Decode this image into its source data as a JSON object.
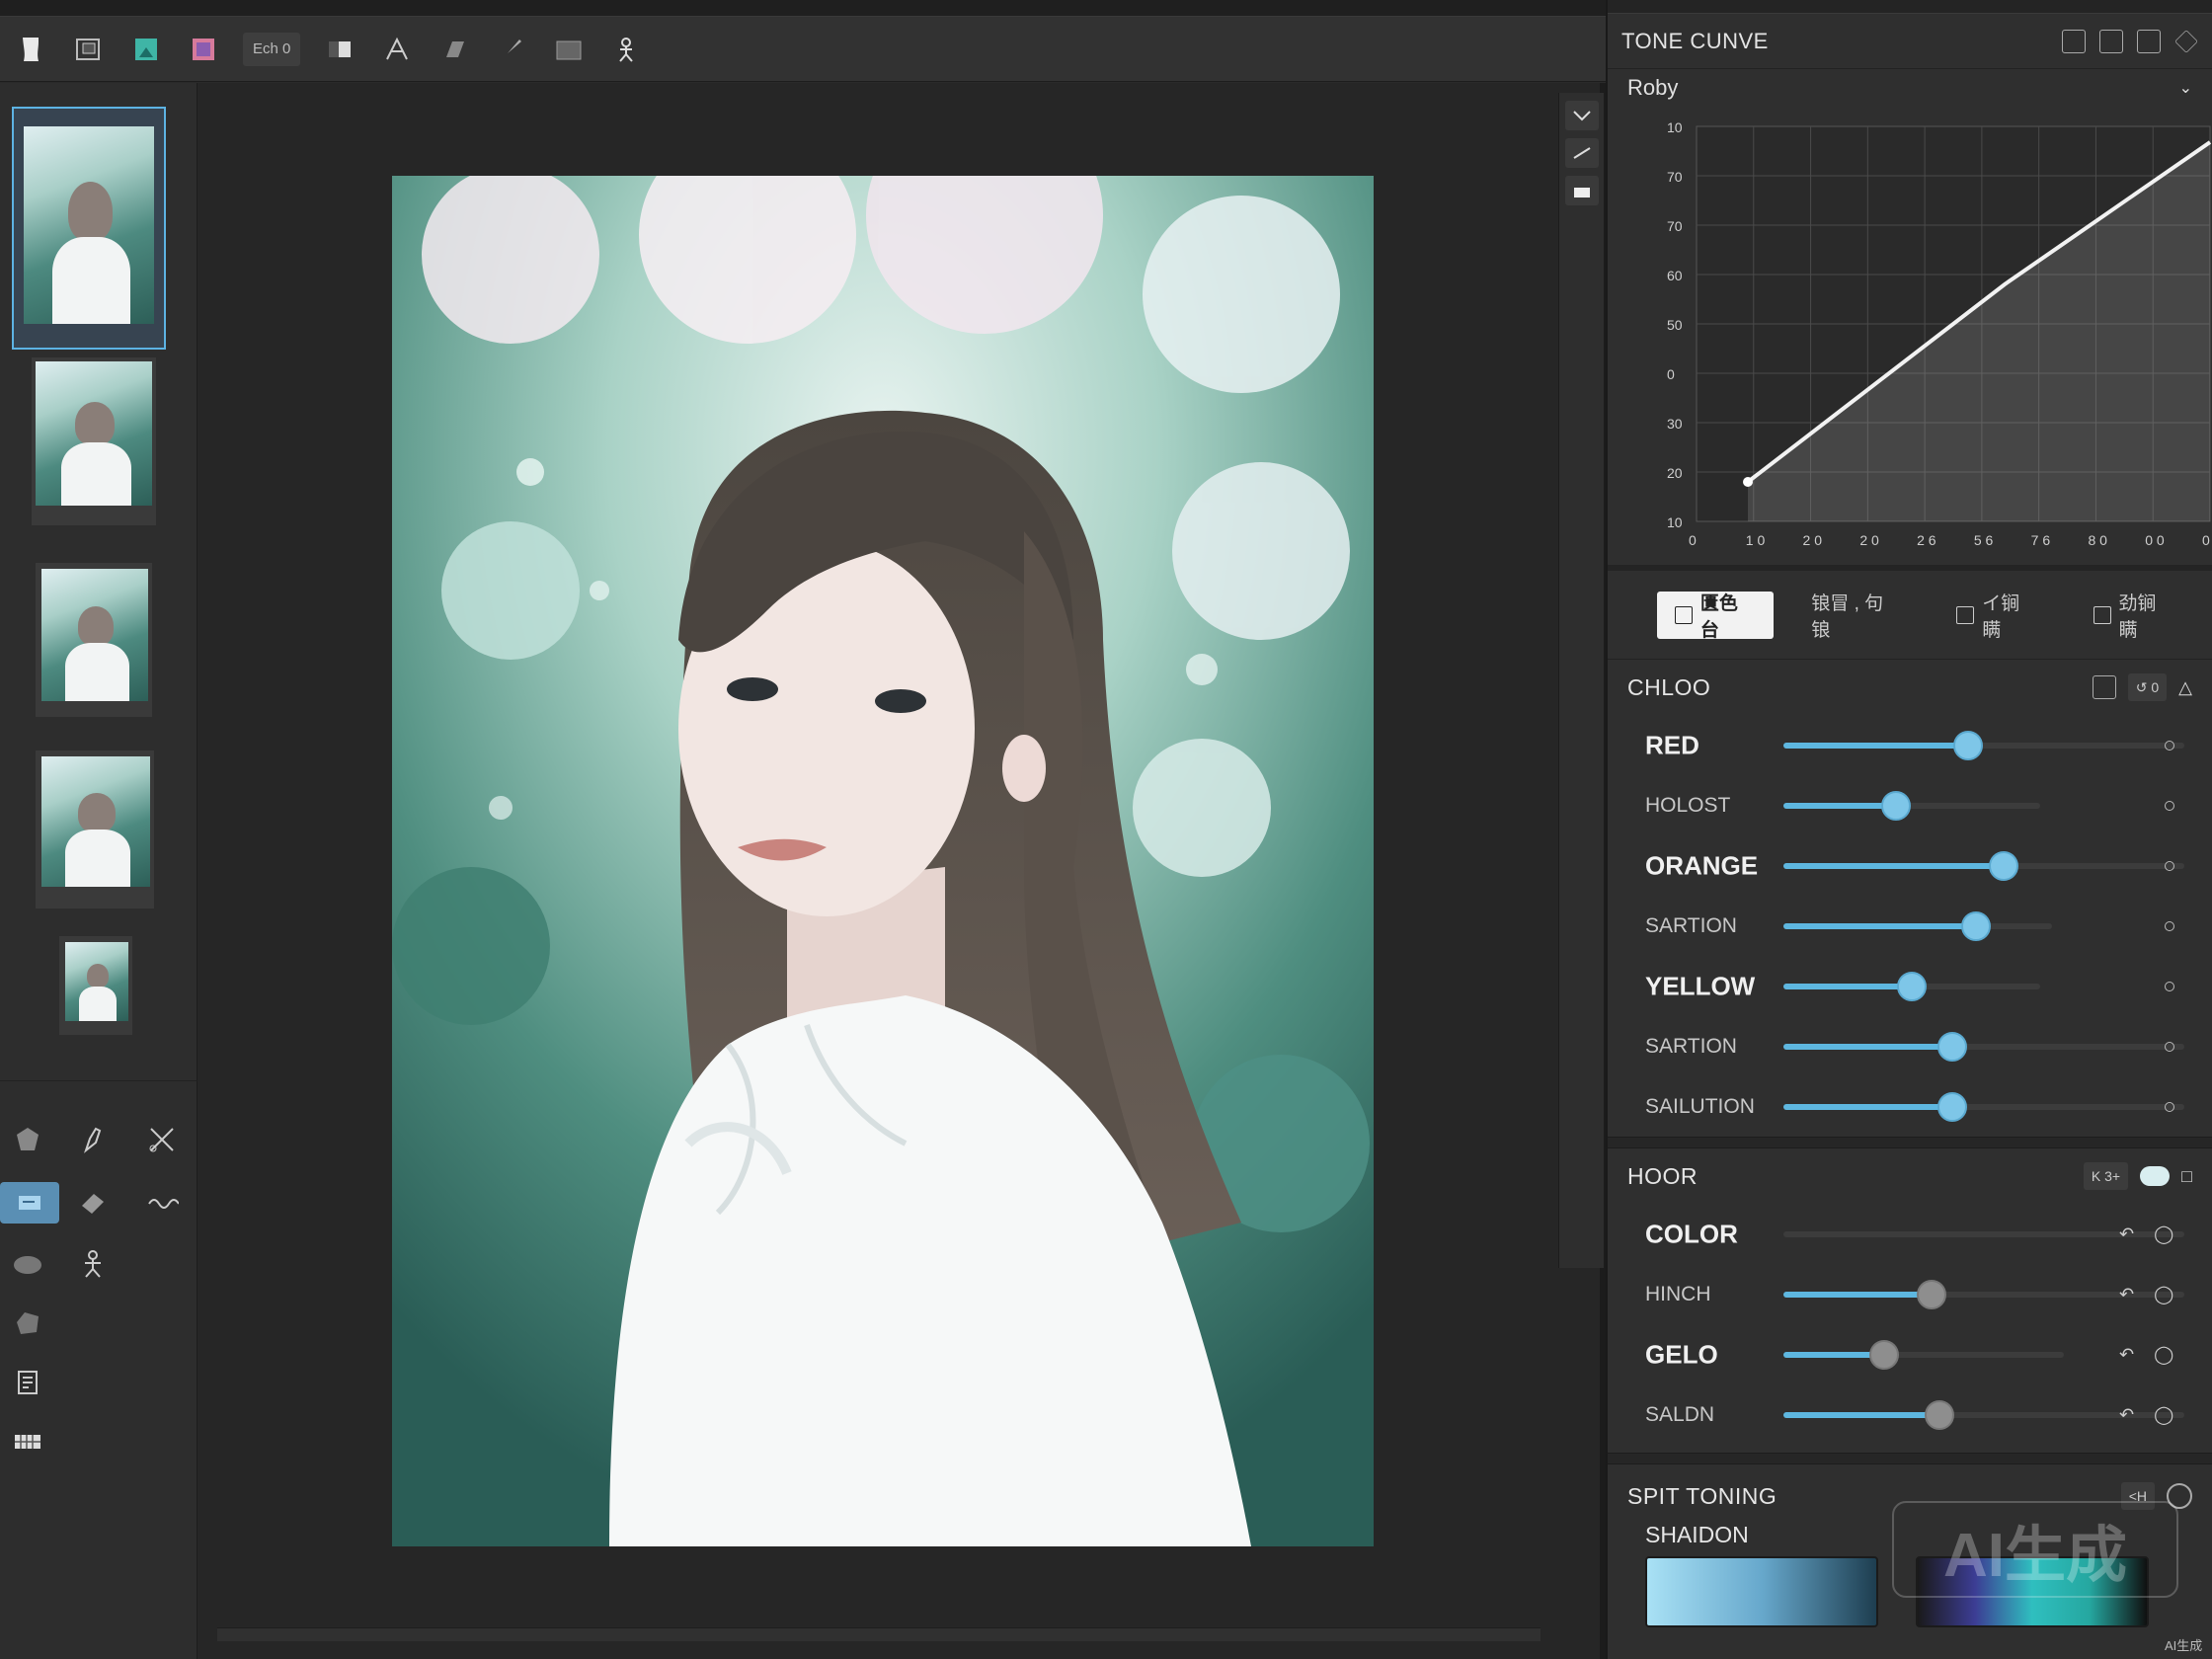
{
  "toolbar": {
    "chip_label": "Ech 0"
  },
  "filmstrip": {
    "thumbs": [
      {
        "label": "",
        "active": true
      },
      {
        "label": "",
        "active": false
      },
      {
        "label": "",
        "active": false
      },
      {
        "label": "",
        "active": false
      },
      {
        "label": "",
        "active": false
      }
    ]
  },
  "tone_curve": {
    "title": "TONE CUNVE",
    "preset": "Roby",
    "y_ticks": [
      "10",
      "70",
      "70",
      "60",
      "50",
      "0",
      "30",
      "20",
      "10"
    ],
    "x_ticks": [
      "0",
      "1 0",
      "2 0",
      "2 0",
      "2 6",
      "5 6",
      "7 6",
      "8 0",
      "0 0",
      "0"
    ],
    "points": [
      [
        10,
        10
      ],
      [
        30,
        30
      ],
      [
        60,
        60
      ],
      [
        100,
        96
      ]
    ]
  },
  "tabs": [
    {
      "label": "匱色台",
      "active": true
    },
    {
      "label": "锒冒 , 句锒",
      "active": false
    },
    {
      "label": "イ锏瞒",
      "active": false
    },
    {
      "label": "劲锏瞒",
      "active": false
    }
  ],
  "color_section": {
    "title": "CHLOO",
    "chip": "↺ 0",
    "rows": [
      {
        "label": "RED",
        "style": "big",
        "value": 0.46,
        "track_end": 1.0,
        "grey": false
      },
      {
        "label": "HOLOST",
        "style": "small",
        "value": 0.28,
        "track_end": 0.64,
        "grey": false
      },
      {
        "label": "ORANGE",
        "style": "big",
        "value": 0.55,
        "track_end": 1.0,
        "grey": false
      },
      {
        "label": "SARTION",
        "style": "small",
        "value": 0.48,
        "track_end": 0.67,
        "grey": false
      },
      {
        "label": "YELLOW",
        "style": "big",
        "value": 0.32,
        "track_end": 0.64,
        "grey": false
      },
      {
        "label": "SARTION",
        "style": "small",
        "value": 0.42,
        "track_end": 1.0,
        "grey": false
      },
      {
        "label": "SAILUTION",
        "style": "small",
        "value": 0.42,
        "track_end": 1.0,
        "grey": false
      }
    ]
  },
  "hsl_section": {
    "title": "HOOR",
    "chip": "K 3+",
    "rows": [
      {
        "label": "COLOR",
        "style": "big",
        "value": 0.0,
        "track_end": 1.0,
        "grey": true
      },
      {
        "label": "HINCH",
        "style": "small",
        "value": 0.37,
        "track_end": 1.0,
        "grey": true
      },
      {
        "label": "GELO",
        "style": "big",
        "value": 0.25,
        "track_end": 0.7,
        "grey": true
      },
      {
        "label": "SALDN",
        "style": "small",
        "value": 0.39,
        "track_end": 1.0,
        "grey": true
      }
    ]
  },
  "split_toning": {
    "title": "SPIT TONING",
    "sublabel": "SHAIDON",
    "chip": "<H"
  },
  "watermark": {
    "main": "AI生成",
    "small": "AI生成"
  },
  "colors": {
    "accent": "#5eb7e0",
    "panel_bg": "#2f2f2f",
    "canvas_bg": "#262626"
  }
}
